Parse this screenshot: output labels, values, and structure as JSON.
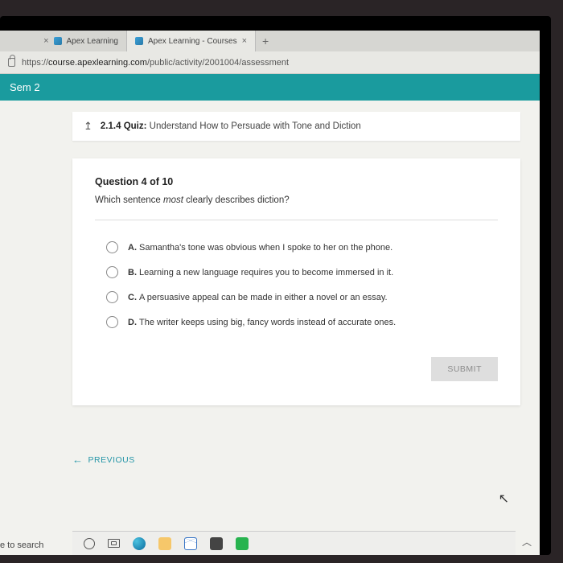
{
  "tabs": [
    {
      "label": "Apex Learning"
    },
    {
      "label": "Apex Learning - Courses"
    }
  ],
  "url_prefix": "https://",
  "url_domain": "course.apexlearning.com",
  "url_path": "/public/activity/2001004/assessment",
  "teal_label": "Sem 2",
  "crumb_num": "2.1.4",
  "crumb_kind": "Quiz:",
  "crumb_title": "Understand How to Persuade with Tone and Diction",
  "q_number": "Question 4 of 10",
  "q_text_pre": "Which sentence ",
  "q_text_em": "most",
  "q_text_post": " clearly describes diction?",
  "options": [
    {
      "letter": "A.",
      "text": "Samantha's tone was obvious when I spoke to her on the phone."
    },
    {
      "letter": "B.",
      "text": "Learning a new language requires you to become immersed in it."
    },
    {
      "letter": "C.",
      "text": "A persuasive appeal can be made in either a novel or an essay."
    },
    {
      "letter": "D.",
      "text": "The writer keeps using big, fancy words instead of accurate ones."
    }
  ],
  "submit_label": "SUBMIT",
  "prev_label": "PREVIOUS",
  "search_hint": "e to search"
}
